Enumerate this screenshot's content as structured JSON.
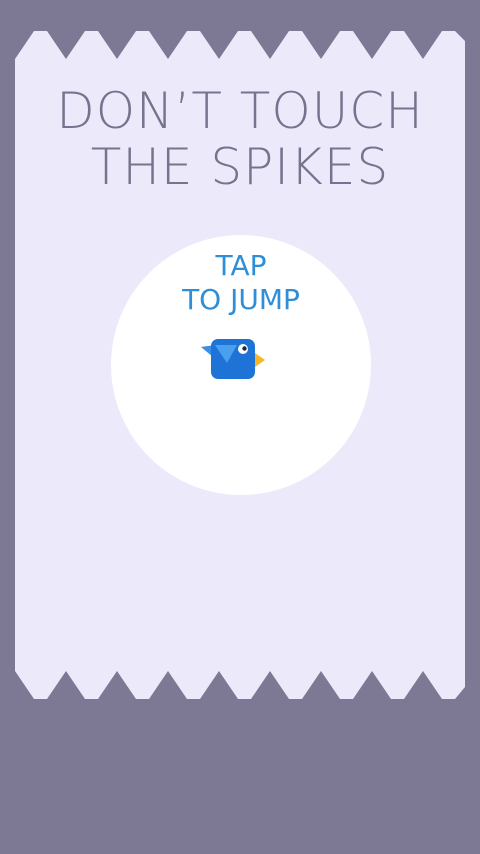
{
  "game": {
    "title_line1": "DON’T TOUCH",
    "title_line2": "THE SPIKES",
    "instruction_line1": "TAP",
    "instruction_line2": "TO JUMP"
  },
  "colors": {
    "background": "#7d7894",
    "arena": "#ece9fb",
    "spikes": "#7d7894",
    "title_text": "#77728e",
    "circle": "#ffffff",
    "instruction_text": "#2e8fd8",
    "bird_body": "#1e74d6",
    "bird_wing": "#3a8ee6",
    "bird_beak": "#f5b72a"
  },
  "icons": {
    "bird": "bird-icon",
    "spike": "spike-triangle"
  }
}
